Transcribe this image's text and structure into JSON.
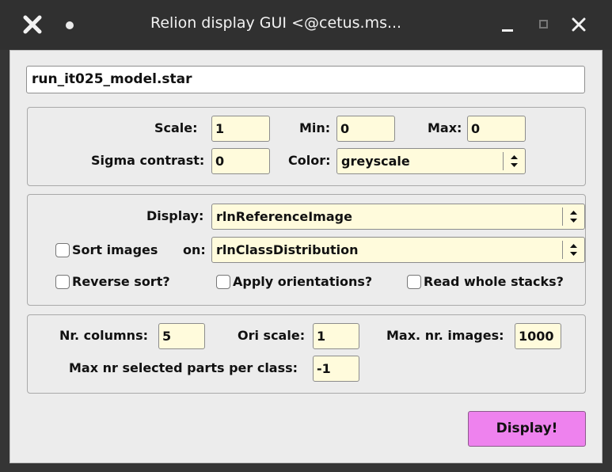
{
  "titlebar": {
    "title": "Relion display GUI <@cetus.ms...",
    "icons": [
      "x-logo-icon",
      "dot-icon",
      "minimize-icon",
      "maximize-icon",
      "close-icon"
    ]
  },
  "file": {
    "value": "run_it025_model.star"
  },
  "display_settings": {
    "scale_label": "Scale:",
    "scale_value": "1",
    "min_label": "Min:",
    "min_value": "0",
    "max_label": "Max:",
    "max_value": "0",
    "sigma_label": "Sigma contrast:",
    "sigma_value": "0",
    "color_label": "Color:",
    "color_value": "greyscale"
  },
  "selection": {
    "display_label": "Display:",
    "display_value": "rlnReferenceImage",
    "sort_label": "Sort images",
    "on_label": "on:",
    "sort_on_value": "rlnClassDistribution",
    "reverse_label": "Reverse sort?",
    "apply_label": "Apply orientations?",
    "read_label": "Read whole stacks?"
  },
  "layout_settings": {
    "columns_label": "Nr. columns:",
    "columns_value": "5",
    "ori_label": "Ori scale:",
    "ori_value": "1",
    "maxnr_label": "Max. nr. images:",
    "maxnr_value": "1000",
    "maxsel_label": "Max nr selected parts per class:",
    "maxsel_value": "-1"
  },
  "actions": {
    "display_button": "Display!"
  },
  "colors": {
    "input_bg": "#fffbdc",
    "button_bg": "#ee82ee",
    "window_bg": "#ececec",
    "titlebar_bg": "#303030"
  }
}
